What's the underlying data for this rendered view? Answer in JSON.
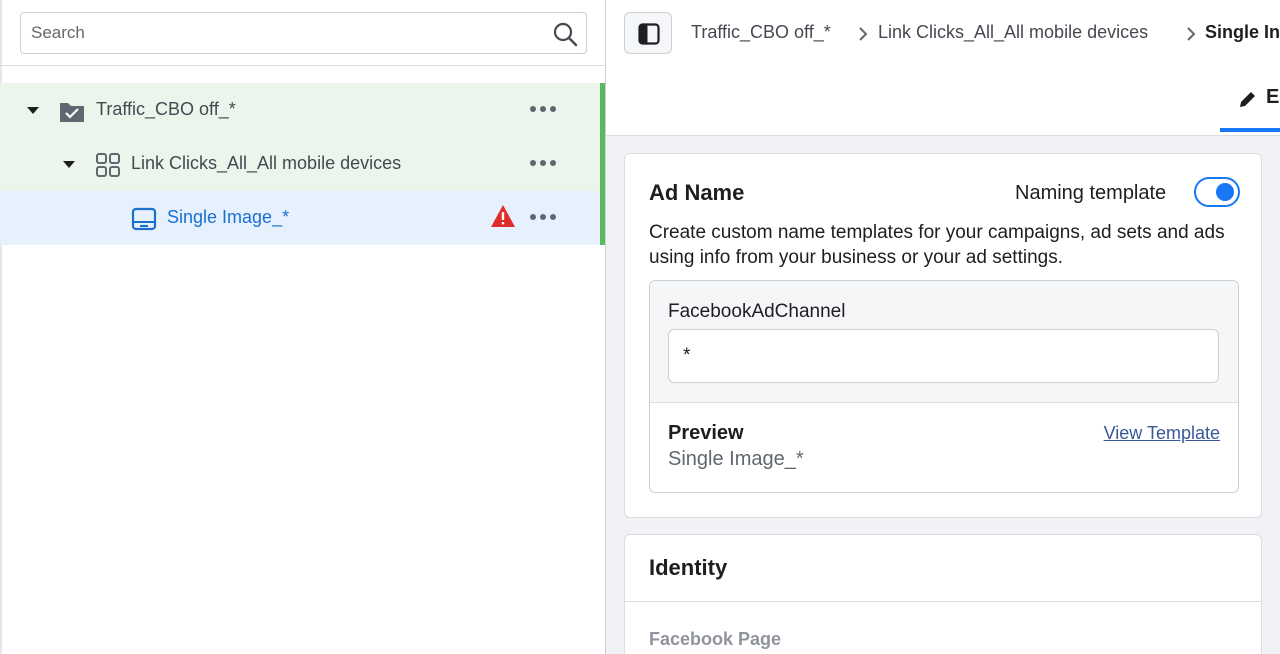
{
  "search": {
    "placeholder": "Search"
  },
  "tree": [
    {
      "label": "Traffic_CBO off_*",
      "icon": "campaign-folder-icon"
    },
    {
      "label": "Link Clicks_All_All mobile devices",
      "icon": "ad-set-grid-icon"
    },
    {
      "label": "Single Image_*",
      "icon": "ad-icon",
      "warning": true
    }
  ],
  "breadcrumb": [
    "Traffic_CBO off_*",
    "Link Clicks_All_All mobile devices",
    "Single In"
  ],
  "tabs": {
    "edit_label": "E"
  },
  "ad_name": {
    "title": "Ad Name",
    "naming_template_label": "Naming template",
    "naming_template_on": true,
    "description": "Create custom name templates for your campaigns, ad sets and ads using info from your business or your ad settings.",
    "field_label": "FacebookAdChannel",
    "field_value": "*",
    "preview_title": "Preview",
    "preview_value": "Single Image_*",
    "view_template_label": "View Template"
  },
  "identity": {
    "title": "Identity",
    "facebook_page_label": "Facebook Page"
  },
  "colors": {
    "accent": "#1877f2",
    "selected_text": "#1a6fd1",
    "tree_active_bar": "#5cb85c",
    "warning": "#e02b2b"
  }
}
